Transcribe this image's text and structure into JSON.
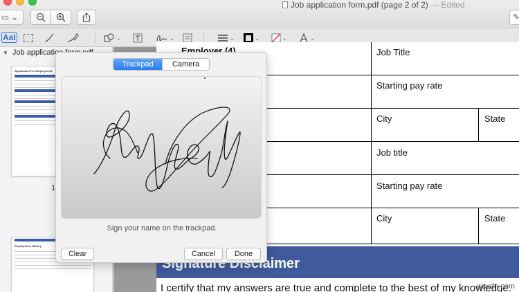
{
  "window": {
    "title": "Job application form.pdf (page 2 of 2)",
    "separator": " — ",
    "status": "Edited",
    "status_caret": "⌄"
  },
  "toolbar": {
    "sidebar_glyph": "▭ ⌄",
    "zoom_out_glyph": "−",
    "zoom_in_glyph": "+",
    "share_glyph": "⇪",
    "edit_glyph": "✎"
  },
  "markup": {
    "text_tool": "AaI",
    "caret": "⌄",
    "tools": [
      "shapes-icon",
      "textbox-icon",
      "sign-icon",
      "note-icon",
      "line-style-icon",
      "border-color-icon",
      "fill-color-icon",
      "font-icon"
    ]
  },
  "sidebar": {
    "doc_title": "Job application form.pdf",
    "disclosure": "▼",
    "page1_label": "1",
    "thumb1_title": "Application For Employment",
    "thumb2_title": "Employment History"
  },
  "document": {
    "employer_header": "Employer (4)",
    "rows": [
      {
        "right": "Job Title"
      },
      {
        "right": "Starting pay rate"
      },
      {
        "right": "City",
        "far_right": "State"
      },
      {
        "right": "Job title"
      },
      {
        "right": "Starting pay rate"
      },
      {
        "right": "City",
        "far_right": "State"
      }
    ],
    "disclaimer_title": "Signature Disclaimer",
    "certify_text": "I certify that my answers are true and complete to the best of my knowledge."
  },
  "signature_panel": {
    "tab_trackpad": "Trackpad",
    "tab_camera": "Camera",
    "active_tab": "Trackpad",
    "hint": "Sign your name on the trackpad.",
    "clear_label": "Clear",
    "cancel_label": "Cancel",
    "done_label": "Done"
  },
  "watermark": "wsxdn.com",
  "colors": {
    "accent": "#2b7bf0",
    "disclaimer_bar": "#3f5b9c",
    "close": "#fc605c",
    "minimize": "#fdbc40",
    "zoom": "#34c84a"
  }
}
